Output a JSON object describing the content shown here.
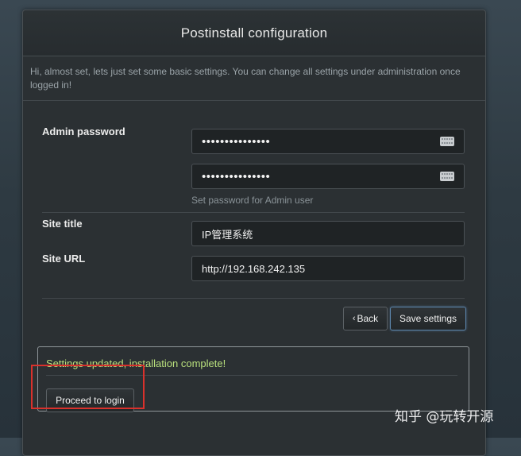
{
  "header": {
    "title": "Postinstall configuration"
  },
  "intro": {
    "text": "Hi, almost set, lets just set some basic settings. You can change all settings under administration once logged in!"
  },
  "form": {
    "admin_password_label": "Admin password",
    "password_value": "•••••••••••••••",
    "password_confirm_value": "•••••••••••••••",
    "password_hint": "Set password for Admin user",
    "site_title_label": "Site title",
    "site_title_value": "IP管理系统",
    "site_url_label": "Site URL",
    "site_url_value": "http://192.168.242.135"
  },
  "actions": {
    "back_label": "Back",
    "save_label": "Save settings"
  },
  "result": {
    "message": "Settings updated, installation complete!",
    "proceed_label": "Proceed to login"
  },
  "icons": {
    "back": "chevron-left-icon",
    "password_field": "keyboard-icon"
  },
  "colors": {
    "success_text": "#b9e07d",
    "highlight": "#d9312c",
    "primary_border": "#5c86ad"
  },
  "watermark": {
    "text": "知乎 @玩转开源"
  }
}
